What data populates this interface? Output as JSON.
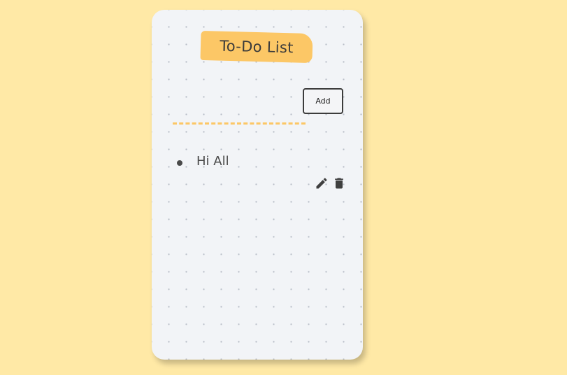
{
  "app": {
    "title": "To-Do List"
  },
  "form": {
    "input_value": "",
    "input_placeholder": "",
    "add_label": "Add"
  },
  "todos": [
    {
      "text": "Hi All"
    }
  ],
  "icons": {
    "edit": "pencil-icon",
    "delete": "trash-icon"
  },
  "colors": {
    "background": "#ffe9a6",
    "card": "#f2f4f7",
    "accent": "#fcc766",
    "text": "#4a4a4a"
  }
}
